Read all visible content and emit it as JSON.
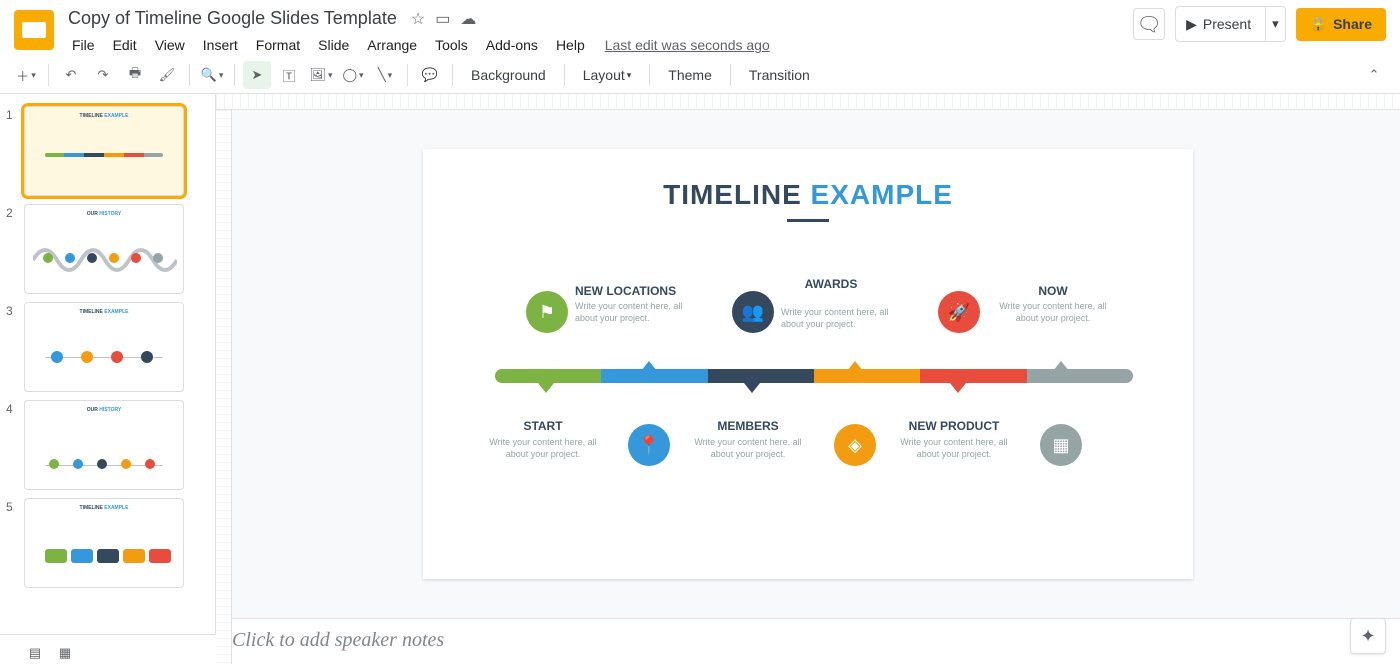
{
  "doc": {
    "title": "Copy of Timeline Google Slides Template",
    "last_edit": "Last edit was seconds ago"
  },
  "menu": [
    "File",
    "Edit",
    "View",
    "Insert",
    "Format",
    "Slide",
    "Arrange",
    "Tools",
    "Add-ons",
    "Help"
  ],
  "header": {
    "present": "Present",
    "share": "Share"
  },
  "toolbar": {
    "background": "Background",
    "layout": "Layout",
    "theme": "Theme",
    "transition": "Transition"
  },
  "thumbs": [
    {
      "n": "1",
      "title1": "TIMELINE",
      "title2": "EXAMPLE"
    },
    {
      "n": "2",
      "title1": "OUR",
      "title2": "HISTORY"
    },
    {
      "n": "3",
      "title1": "TIMELINE",
      "title2": "EXAMPLE"
    },
    {
      "n": "4",
      "title1": "OUR",
      "title2": "HISTORY"
    },
    {
      "n": "5",
      "title1": "TIMELINE",
      "title2": "EXAMPLE"
    }
  ],
  "slide": {
    "title1": "TIMELINE",
    "title2": "EXAMPLE",
    "subtext": "Write your content here, all about your project.",
    "top": [
      {
        "label": "NEW LOCATIONS",
        "color": "c-green",
        "icon": "⚑"
      },
      {
        "label": "AWARDS",
        "color": "c-dark",
        "icon": "👥"
      },
      {
        "label": "NOW",
        "color": "c-red",
        "icon": "🚀"
      }
    ],
    "bottom": [
      {
        "label": "START",
        "color": "",
        "icon": ""
      },
      {
        "label": "MEMBERS",
        "color": "c-blue",
        "icon": "📍"
      },
      {
        "label": "NEW PRODUCT",
        "color": "c-orange",
        "icon": "◈"
      },
      {
        "label": "",
        "color": "c-grey",
        "icon": "▦"
      }
    ],
    "segments": [
      "c-green",
      "c-blue",
      "c-dark",
      "c-orange",
      "c-red",
      "c-grey"
    ]
  },
  "notes": {
    "placeholder": "Click to add speaker notes"
  }
}
